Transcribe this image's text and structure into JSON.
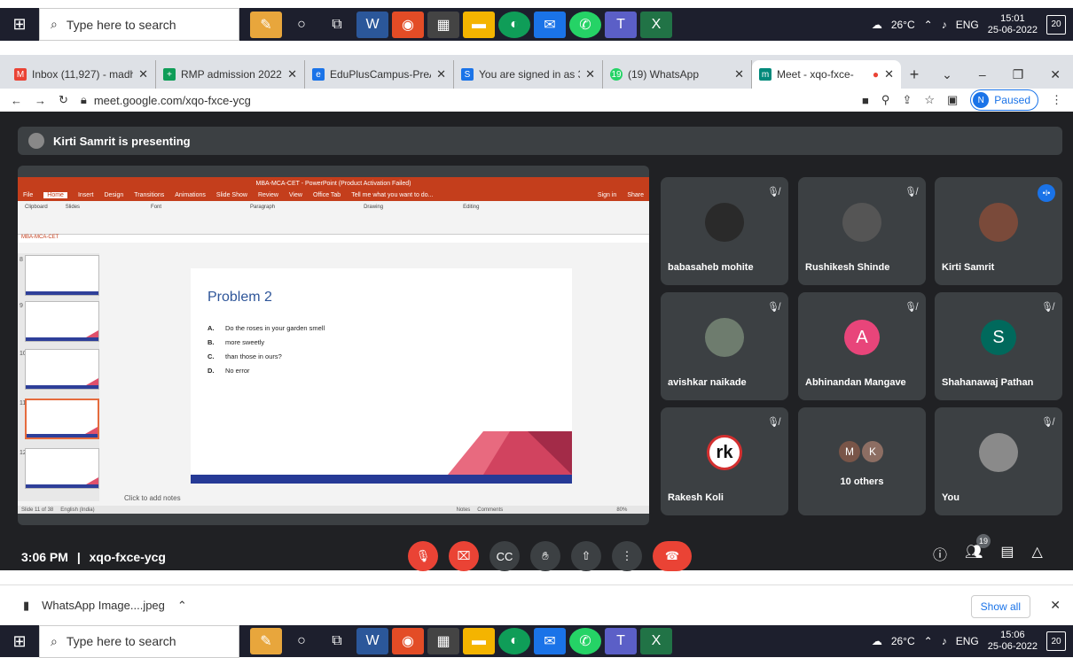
{
  "taskbar_top": {
    "search_placeholder": "Type here to search",
    "weather": "26°C",
    "lang": "ENG",
    "time": "15:01",
    "date": "25-06-2022",
    "notif_count": "20"
  },
  "taskbar_bottom": {
    "search_placeholder": "Type here to search",
    "weather": "26°C",
    "lang": "ENG",
    "time": "15:06",
    "date": "25-06-2022",
    "notif_count": "20"
  },
  "browser": {
    "tabs": [
      {
        "label": "Inbox (11,927) - madh",
        "icon": "M"
      },
      {
        "label": "RMP admission 2022 -",
        "icon": "+"
      },
      {
        "label": "EduPlusCampus-PreA",
        "icon": "e"
      },
      {
        "label": "You are signed in as 3",
        "icon": "S"
      },
      {
        "label": "(19) WhatsApp",
        "icon": "19"
      },
      {
        "label": "Meet - xqo-fxce-",
        "icon": "m"
      }
    ],
    "url": "meet.google.com/xqo-fxce-ycg",
    "profile_initial": "N",
    "profile_status": "Paused"
  },
  "meet": {
    "presenting_text": "Kirti Samrit is presenting",
    "meeting_time": "3:06 PM",
    "meeting_code": "xqo-fxce-ycg",
    "participant_count": "19",
    "participants": [
      {
        "name": "babasaheb mohite"
      },
      {
        "name": "Rushikesh Shinde"
      },
      {
        "name": "Kirti Samrit"
      },
      {
        "name": "avishkar naikade"
      },
      {
        "name": "Abhinandan Mangave",
        "initial": "A"
      },
      {
        "name": "Shahanawaj Pathan",
        "initial": "S"
      },
      {
        "name": "Rakesh Koli",
        "initial": "rk"
      },
      {
        "name": "10 others",
        "initials": [
          "M",
          "K"
        ]
      },
      {
        "name": "You"
      }
    ]
  },
  "ppt": {
    "window_title": "MBA-MCA-CET - PowerPoint (Product Activation Failed)",
    "menu": [
      "File",
      "Home",
      "Insert",
      "Design",
      "Transitions",
      "Animations",
      "Slide Show",
      "Review",
      "View",
      "Office Tab",
      "Tell me what you want to do..."
    ],
    "sign_in": "Sign in",
    "share": "Share",
    "doc_tab": "MBA-MCA-CET",
    "ribbon_groups": [
      "Clipboard",
      "Slides",
      "Font",
      "Paragraph",
      "Drawing",
      "Editing"
    ],
    "thumb_numbers": [
      "8",
      "9",
      "10",
      "11",
      "12"
    ],
    "slide_title": "Problem 2",
    "slide_items": [
      {
        "letter": "A.",
        "text": "Do the roses in your garden smell"
      },
      {
        "letter": "B.",
        "text": "more sweetly"
      },
      {
        "letter": "C.",
        "text": "than those in ours?"
      },
      {
        "letter": "D.",
        "text": "No error"
      }
    ],
    "notes_placeholder": "Click to add notes",
    "status_left": "Slide 11 of 38",
    "status_lang": "English (India)",
    "status_notes": "Notes",
    "status_comments": "Comments",
    "zoom": "80%"
  },
  "download": {
    "file": "WhatsApp Image....jpeg",
    "show_all": "Show all"
  },
  "colors": {
    "meet_bg": "#202124",
    "tile_bg": "#3c4043",
    "end_red": "#ea4335",
    "ppt_red": "#c43e1c",
    "slide_title": "#2e5599"
  }
}
